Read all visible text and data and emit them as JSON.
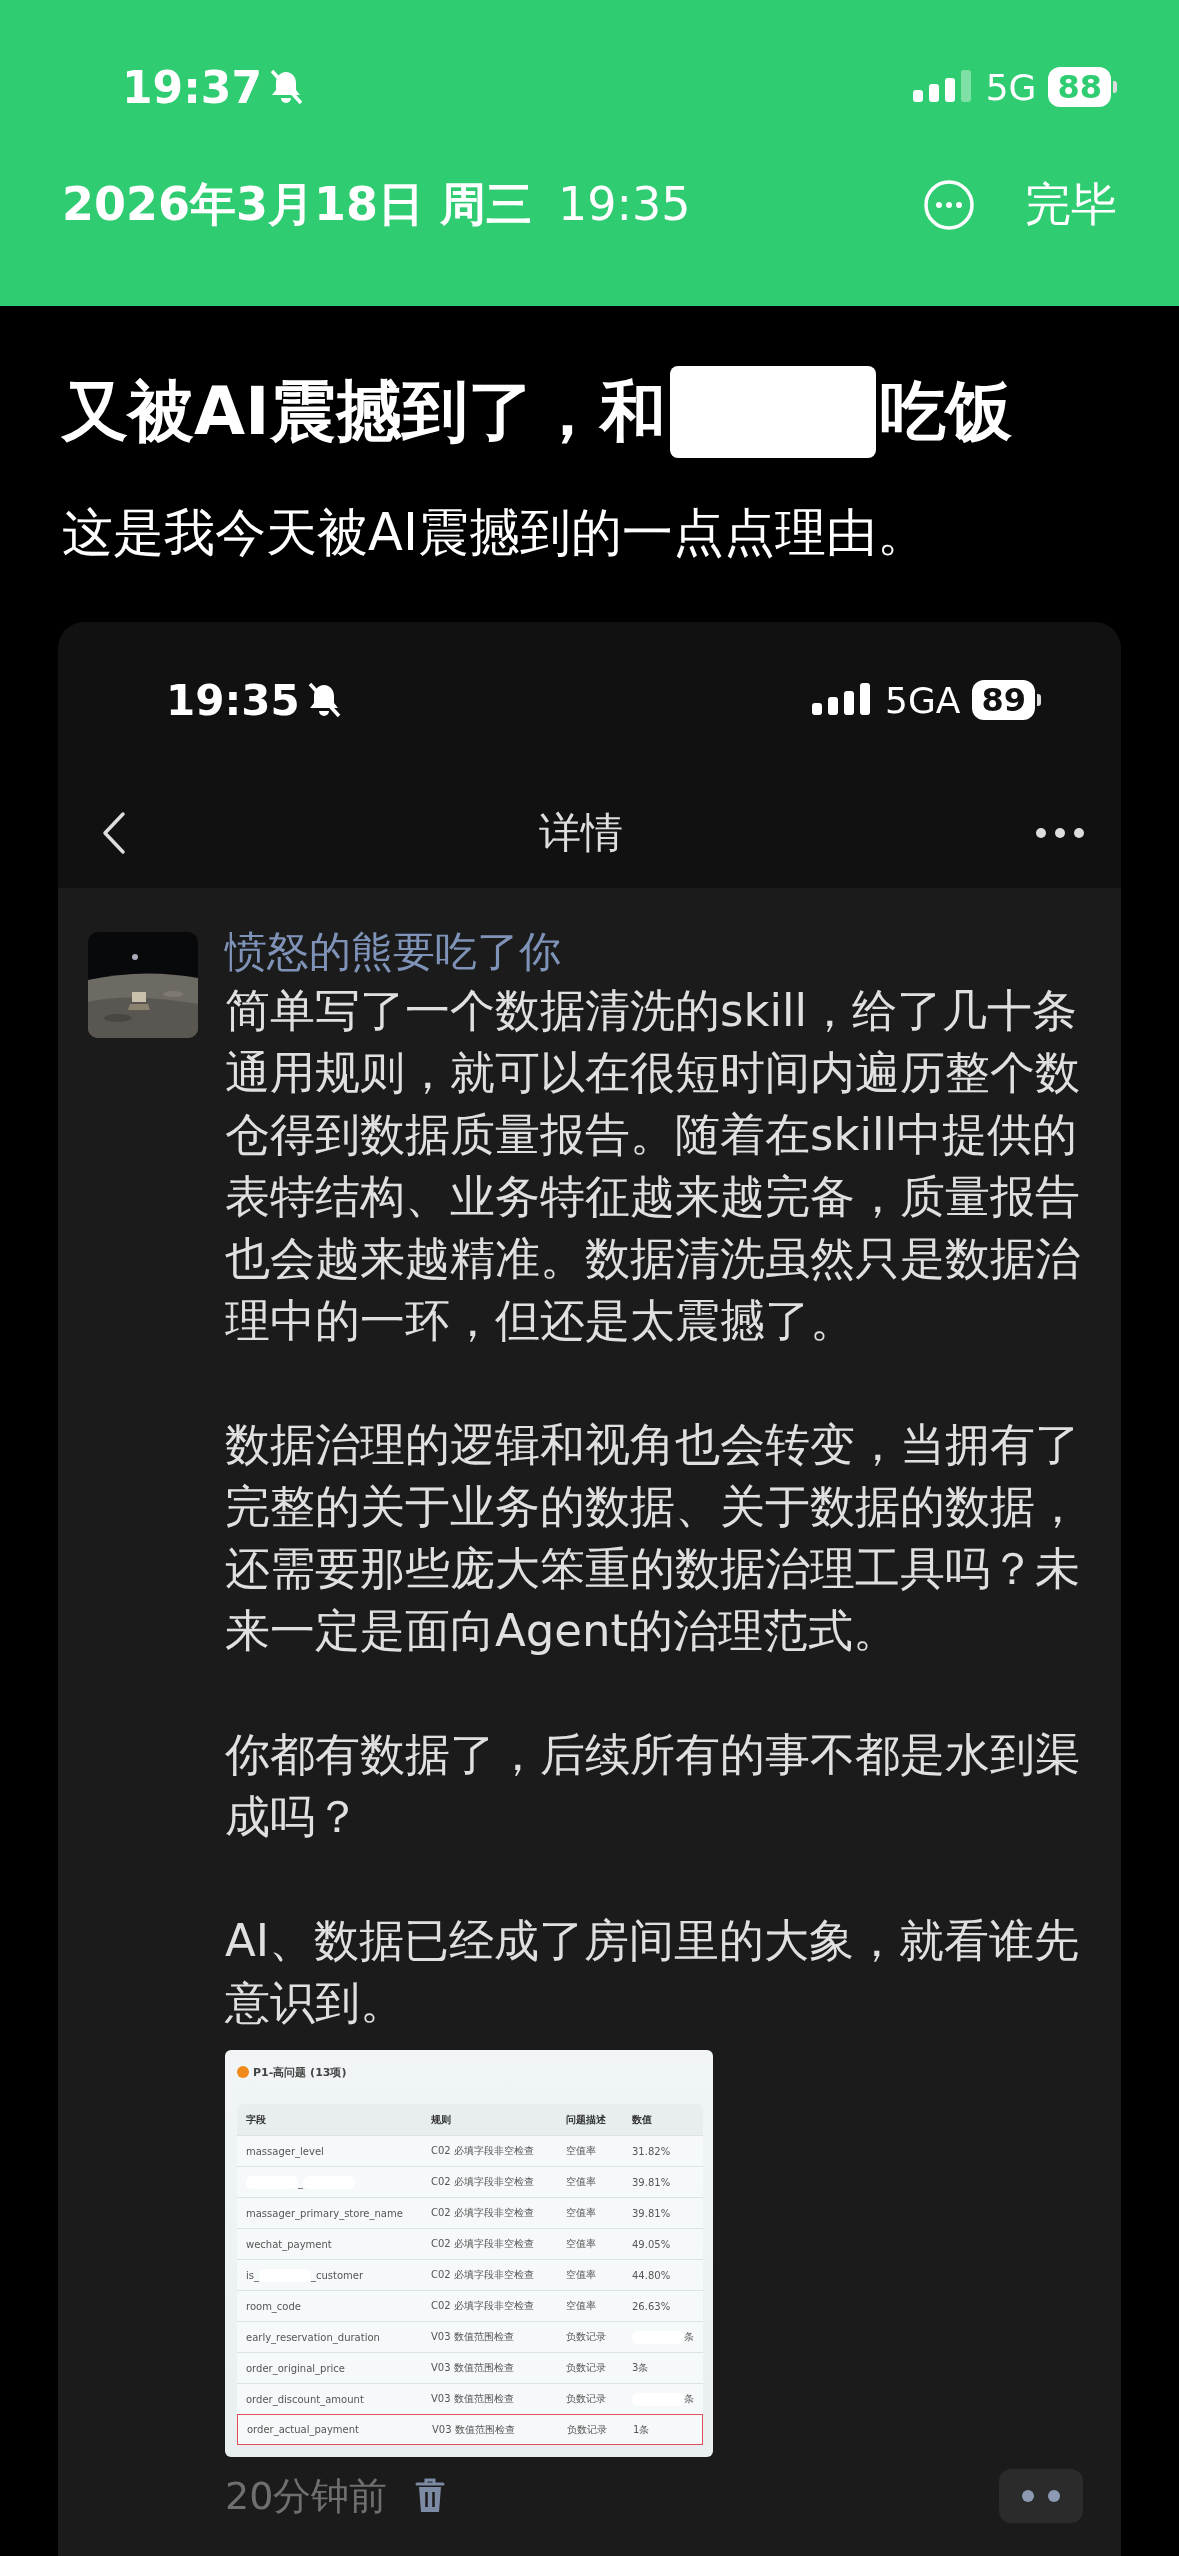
{
  "status_bar": {
    "time": "19:37",
    "network": "5G",
    "battery": "88"
  },
  "note_header": {
    "date": "2026年3月18日 周三",
    "time": "19:35",
    "done_button": "完毕"
  },
  "article": {
    "title_parts": [
      {
        "kind": "text",
        "text": "又被AI震撼到了，和"
      },
      {
        "kind": "redacted"
      },
      {
        "kind": "text",
        "text": "吃饭"
      }
    ],
    "subtitle": "这是我今天被AI震撼到的一点点理由。"
  },
  "screenshot": {
    "status_bar": {
      "time": "19:35",
      "network": "5GA",
      "battery": "89"
    },
    "nav_title": "详情",
    "post": {
      "author": "愤怒的熊要吃了你",
      "paragraphs": [
        "简单写了一个数据清洗的skill，给了几十条通用规则，就可以在很短时间内遍历整个数仓得到数据质量报告。随着在skill中提供的表特结构、业务特征越来越完备，质量报告也会越来越精准。数据清洗虽然只是数据治理中的一环，但还是太震撼了。",
        "数据治理的逻辑和视角也会转变，当拥有了完整的关于业务的数据、关于数据的数据，还需要那些庞大笨重的数据治理工具吗？未来一定是面向Agent的治理范式。",
        "你都有数据了，后续所有的事不都是水到渠成吗？",
        "AI、数据已经成了房间里的大象，就看谁先意识到。"
      ],
      "image": {
        "title": "P1-高问题 (13项)",
        "columns": [
          "字段",
          "规则",
          "问题描述",
          "数值"
        ],
        "rows": [
          {
            "highlighted": false,
            "cells": [
              [
                {
                  "kind": "text",
                  "text": "massager_level"
                }
              ],
              [
                {
                  "kind": "text",
                  "text": "C02 必填字段非空检查"
                }
              ],
              [
                {
                  "kind": "text",
                  "text": "空值率"
                }
              ],
              [
                {
                  "kind": "text",
                  "text": "31.82%"
                }
              ]
            ]
          },
          {
            "highlighted": false,
            "cells": [
              [
                {
                  "kind": "redacted"
                },
                {
                  "kind": "text",
                  "text": "_"
                },
                {
                  "kind": "redacted"
                }
              ],
              [
                {
                  "kind": "text",
                  "text": "C02 必填字段非空检查"
                }
              ],
              [
                {
                  "kind": "text",
                  "text": "空值率"
                }
              ],
              [
                {
                  "kind": "text",
                  "text": "39.81%"
                }
              ]
            ]
          },
          {
            "highlighted": false,
            "cells": [
              [
                {
                  "kind": "text",
                  "text": "massager_primary_store_name"
                }
              ],
              [
                {
                  "kind": "text",
                  "text": "C02 必填字段非空检查"
                }
              ],
              [
                {
                  "kind": "text",
                  "text": "空值率"
                }
              ],
              [
                {
                  "kind": "text",
                  "text": "39.81%"
                }
              ]
            ]
          },
          {
            "highlighted": false,
            "cells": [
              [
                {
                  "kind": "text",
                  "text": "wechat_payment"
                }
              ],
              [
                {
                  "kind": "text",
                  "text": "C02 必填字段非空检查"
                }
              ],
              [
                {
                  "kind": "text",
                  "text": "空值率"
                }
              ],
              [
                {
                  "kind": "text",
                  "text": "49.05%"
                }
              ]
            ]
          },
          {
            "highlighted": false,
            "cells": [
              [
                {
                  "kind": "text",
                  "text": "is_"
                },
                {
                  "kind": "redacted"
                },
                {
                  "kind": "text",
                  "text": "_customer"
                }
              ],
              [
                {
                  "kind": "text",
                  "text": "C02 必填字段非空检查"
                }
              ],
              [
                {
                  "kind": "text",
                  "text": "空值率"
                }
              ],
              [
                {
                  "kind": "text",
                  "text": "44.80%"
                }
              ]
            ]
          },
          {
            "highlighted": false,
            "cells": [
              [
                {
                  "kind": "text",
                  "text": "room_code"
                }
              ],
              [
                {
                  "kind": "text",
                  "text": "C02 必填字段非空检查"
                }
              ],
              [
                {
                  "kind": "text",
                  "text": "空值率"
                }
              ],
              [
                {
                  "kind": "text",
                  "text": "26.63%"
                }
              ]
            ]
          },
          {
            "highlighted": false,
            "cells": [
              [
                {
                  "kind": "text",
                  "text": "early_reservation_duration"
                }
              ],
              [
                {
                  "kind": "text",
                  "text": "V03 数值范围检查"
                }
              ],
              [
                {
                  "kind": "text",
                  "text": "负数记录"
                }
              ],
              [
                {
                  "kind": "redacted"
                },
                {
                  "kind": "text",
                  "text": "条"
                }
              ]
            ]
          },
          {
            "highlighted": false,
            "cells": [
              [
                {
                  "kind": "text",
                  "text": "order_original_price"
                }
              ],
              [
                {
                  "kind": "text",
                  "text": "V03 数值范围检查"
                }
              ],
              [
                {
                  "kind": "text",
                  "text": "负数记录"
                }
              ],
              [
                {
                  "kind": "text",
                  "text": "3条"
                }
              ]
            ]
          },
          {
            "highlighted": false,
            "cells": [
              [
                {
                  "kind": "text",
                  "text": "order_discount_amount"
                }
              ],
              [
                {
                  "kind": "text",
                  "text": "V03 数值范围检查"
                }
              ],
              [
                {
                  "kind": "text",
                  "text": "负数记录"
                }
              ],
              [
                {
                  "kind": "redacted"
                },
                {
                  "kind": "text",
                  "text": "条"
                }
              ]
            ]
          },
          {
            "highlighted": true,
            "cells": [
              [
                {
                  "kind": "text",
                  "text": "order_actual_payment"
                }
              ],
              [
                {
                  "kind": "text",
                  "text": "V03 数值范围检查"
                }
              ],
              [
                {
                  "kind": "text",
                  "text": "负数记录"
                }
              ],
              [
                {
                  "kind": "text",
                  "text": "1条"
                }
              ]
            ]
          }
        ]
      }
    },
    "footer": {
      "time": "20分钟前"
    }
  }
}
